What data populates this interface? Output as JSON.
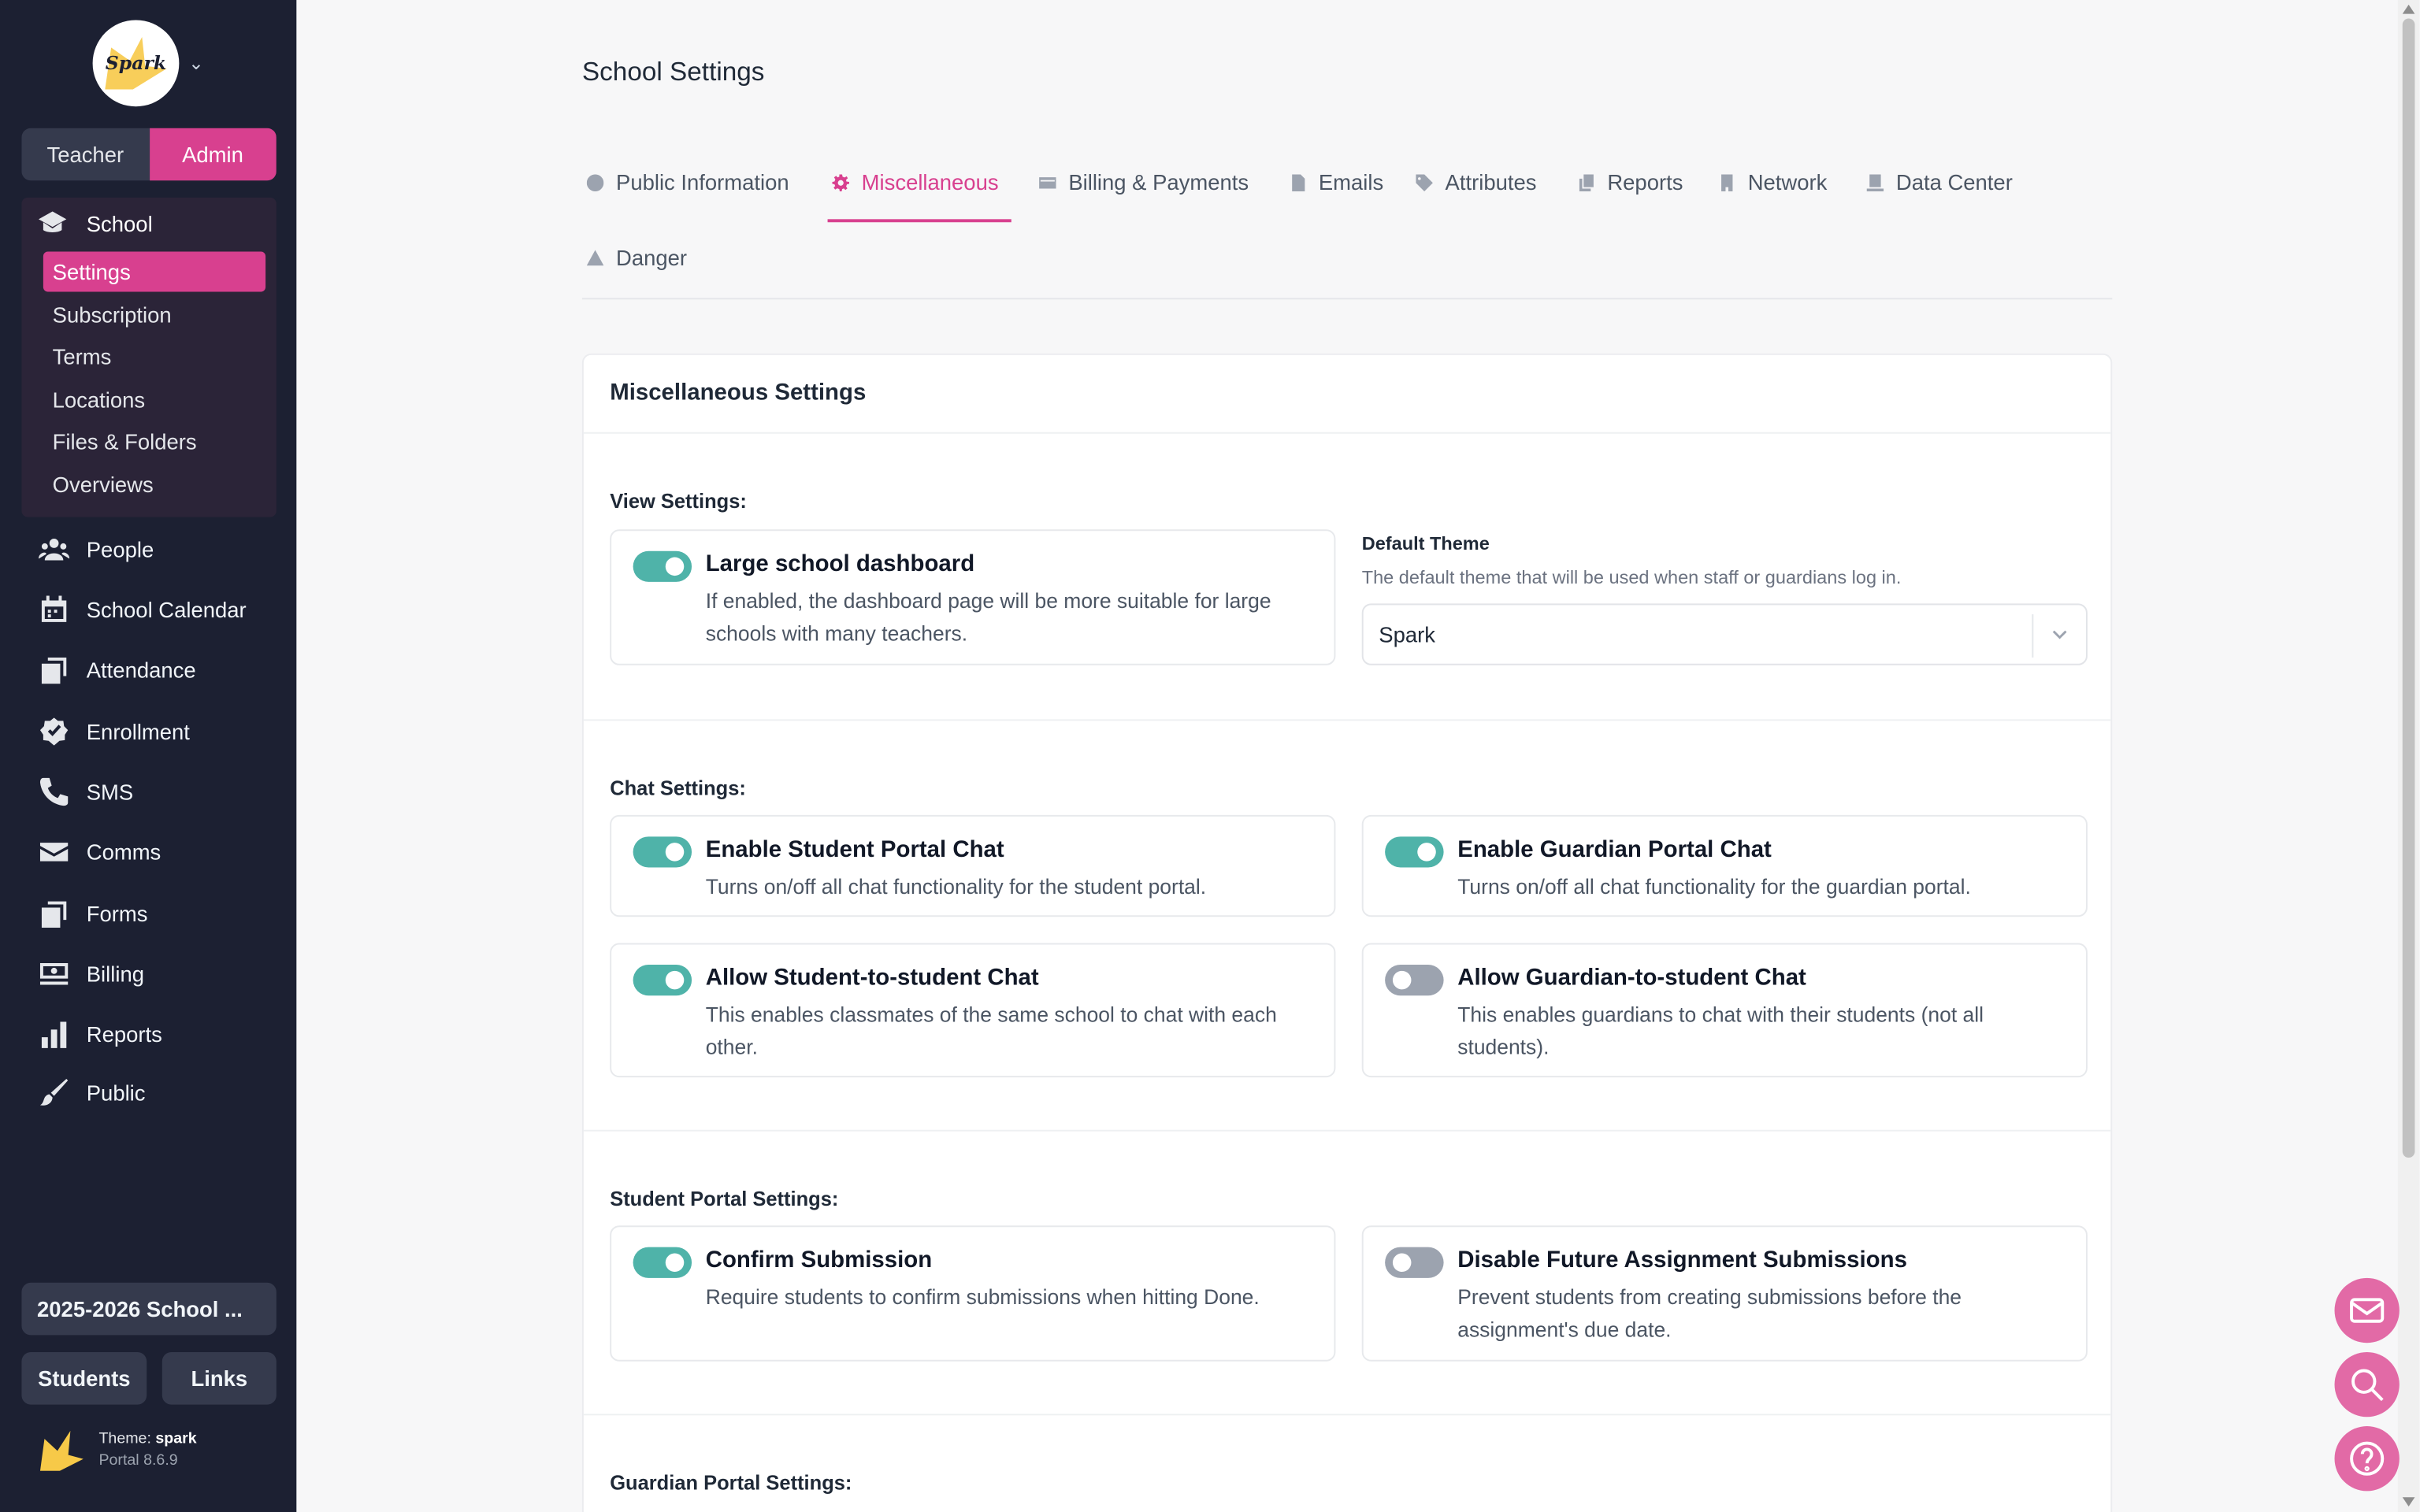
{
  "sidebar": {
    "logo_text": "Spark",
    "roles": {
      "teacher": "Teacher",
      "admin": "Admin"
    },
    "school": {
      "label": "School",
      "items": [
        "Settings",
        "Subscription",
        "Terms",
        "Locations",
        "Files & Folders",
        "Overviews"
      ]
    },
    "nav": [
      "People",
      "School Calendar",
      "Attendance",
      "Enrollment",
      "SMS",
      "Comms",
      "Forms",
      "Billing",
      "Reports",
      "Public"
    ],
    "year_button": "2025-2026 School ...",
    "students_button": "Students",
    "links_button": "Links",
    "theme_label": "Theme:",
    "theme_name": "spark",
    "portal_version": "Portal 8.6.9"
  },
  "main": {
    "title": "School Settings",
    "tabs": [
      "Public Information",
      "Miscellaneous",
      "Billing & Payments",
      "Emails",
      "Attributes",
      "Reports",
      "Network",
      "Data Center",
      "Danger"
    ],
    "card_title": "Miscellaneous Settings",
    "view_settings": {
      "title": "View Settings:",
      "large_dashboard": {
        "title": "Large school dashboard",
        "desc": "If enabled, the dashboard page will be more suitable for large schools with many teachers.",
        "enabled": true
      },
      "default_theme": {
        "label": "Default Theme",
        "hint": "The default theme that will be used when staff or guardians log in.",
        "value": "Spark"
      }
    },
    "chat_settings": {
      "title": "Chat Settings:",
      "student_portal_chat": {
        "title": "Enable Student Portal Chat",
        "desc": "Turns on/off all chat functionality for the student portal.",
        "enabled": true
      },
      "guardian_portal_chat": {
        "title": "Enable Guardian Portal Chat",
        "desc": "Turns on/off all chat functionality for the guardian portal.",
        "enabled": true
      },
      "student_to_student": {
        "title": "Allow Student-to-student Chat",
        "desc": "This enables classmates of the same school to chat with each other.",
        "enabled": true
      },
      "guardian_to_student": {
        "title": "Allow Guardian-to-student Chat",
        "desc": "This enables guardians to chat with their students (not all students).",
        "enabled": false
      }
    },
    "student_portal_settings": {
      "title": "Student Portal Settings:",
      "confirm_submission": {
        "title": "Confirm Submission",
        "desc": "Require students to confirm submissions when hitting Done.",
        "enabled": true
      },
      "disable_future": {
        "title": "Disable Future Assignment Submissions",
        "desc": "Prevent students from creating submissions before the assignment's due date.",
        "enabled": false
      }
    },
    "guardian_portal_settings": {
      "title": "Guardian Portal Settings:"
    }
  },
  "colors": {
    "accent": "#d8408f",
    "toggle_on": "#4fb3a9",
    "sidebar_bg": "#1c2032"
  }
}
